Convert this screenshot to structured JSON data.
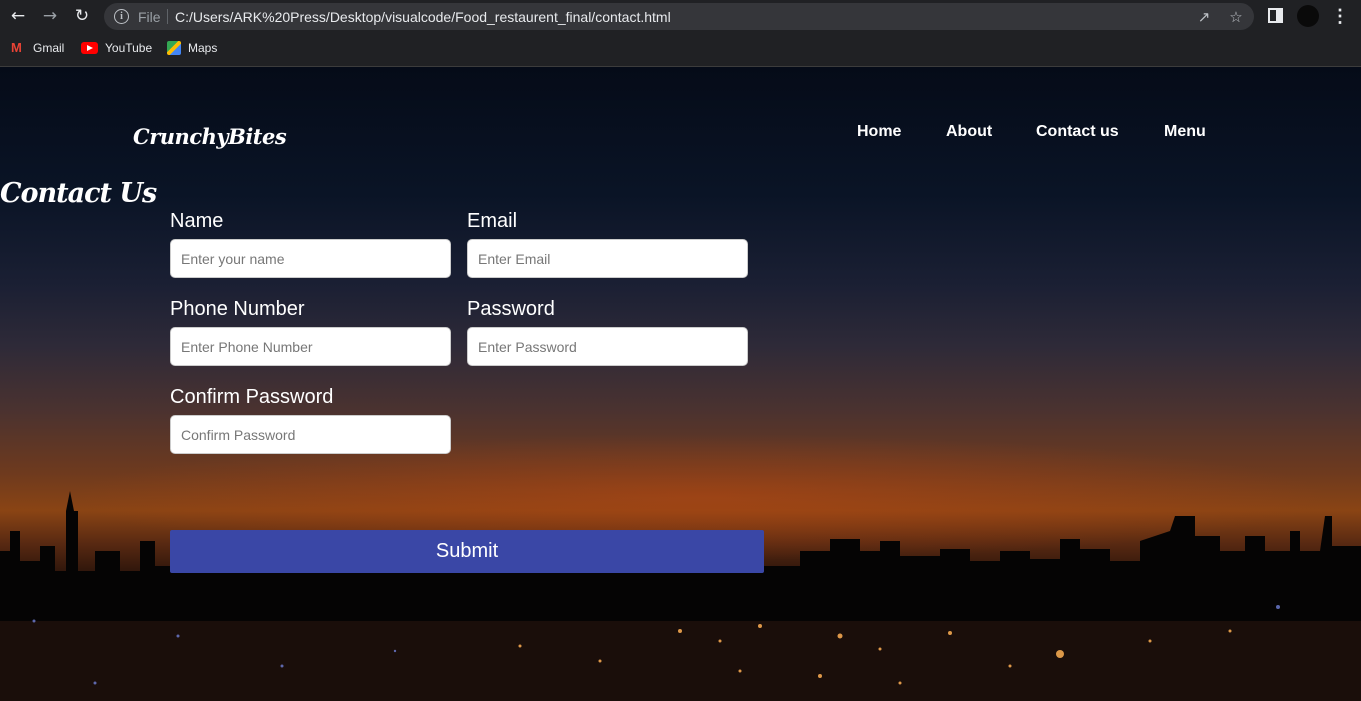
{
  "browser": {
    "back_icon": "arrow-left-icon",
    "forward_icon": "arrow-right-icon",
    "reload_icon": "reload-icon",
    "scheme": "File",
    "url": "C:/Users/ARK%20Press/Desktop/visualcode/Food_restaurent_final/contact.html",
    "bookmarks": [
      "Gmail",
      "YouTube",
      "Maps"
    ]
  },
  "site": {
    "logo": "CrunchyBites",
    "nav": [
      "Home",
      "About",
      "Contact us",
      "Menu"
    ]
  },
  "contact": {
    "title": "Contact Us",
    "fields": {
      "name": {
        "label": "Name",
        "placeholder": "Enter your name"
      },
      "email": {
        "label": "Email",
        "placeholder": "Enter Email"
      },
      "phone": {
        "label": "Phone Number",
        "placeholder": "Enter Phone Number"
      },
      "password": {
        "label": "Password",
        "placeholder": "Enter Password"
      },
      "confirm": {
        "label": "Confirm Password",
        "placeholder": "Confirm Password"
      }
    },
    "submit_label": "Submit"
  },
  "colors": {
    "submit_bg": "#3a47a6",
    "chrome_bg": "#202124"
  }
}
